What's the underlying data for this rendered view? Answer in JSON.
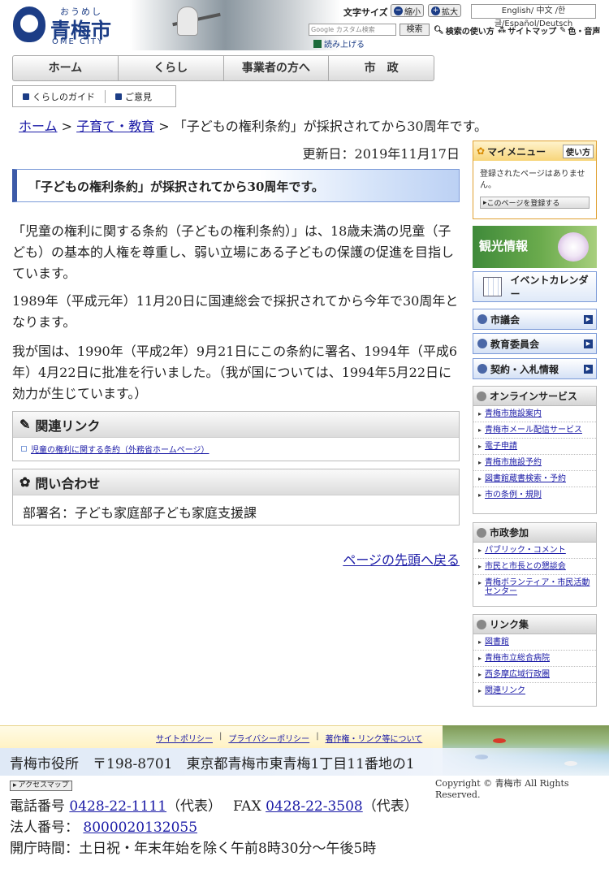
{
  "header": {
    "logo_kana": "おうめし",
    "logo_name": "青梅市",
    "logo_en": "OME CITY",
    "font_size_label": "文字サイズ",
    "shrink_label": "縮小",
    "enlarge_label": "拡大",
    "languages": "English/ 中文 /한글/Español/Deutsch",
    "search_placeholder": "Google カスタム検索",
    "search_button": "検索",
    "search_help": "検索の使い方",
    "sitemap": "サイトマップ",
    "color_voice": "色・音声",
    "read_aloud": "読み上げる"
  },
  "gnav": [
    "ホーム",
    "くらし",
    "事業者の方へ",
    "市　政"
  ],
  "subnav": {
    "guide": "くらしのガイド",
    "opinion": "ご意見"
  },
  "breadcrumb": {
    "home": "ホーム",
    "sep1": " > ",
    "category": "子育て・教育",
    "sep2": " > ",
    "current": "「子どもの権利条約」が採択されてから30周年です。"
  },
  "main": {
    "updated": "更新日：2019年11月17日",
    "title": "「子どもの権利条約」が採択されてから30周年です。",
    "para1": "「児童の権利に関する条約（子どもの権利条約）」は、18歳未満の児童（子ども）の基本的人権を尊重し、弱い立場にある子どもの保護の促進を目指しています。",
    "para2": "1989年（平成元年）11月20日に国連総会で採択されてから今年で30周年となります。",
    "para3": "我が国は、1990年（平成2年）9月21日にこの条約に署名、1994年（平成6年）4月22日に批准を行いました。（我が国については、1994年5月22日に効力が生じています。）",
    "related_heading": "関連リンク",
    "related_link": "児童の権利に関する条約（外務省ホームページ）",
    "contact_heading": "問い合わせ",
    "contact_dept": "部署名：子ども家庭部子ども家庭支援課",
    "page_top": "ページの先頭へ戻る"
  },
  "sidebar": {
    "mymenu_title": "マイメニュー",
    "mymenu_howto": "使い方",
    "mymenu_msg": "登録されたページはありません。",
    "mymenu_register": "このページを登録する",
    "tourism": "観光情報",
    "event_calendar": "イベントカレンダー",
    "council": "市議会",
    "education": "教育委員会",
    "contract": "契約・入札情報",
    "online_title": "オンラインサービス",
    "online_items": [
      "青梅市施設案内",
      "青梅市メール配信サービス",
      "電子申請",
      "青梅市施設予約",
      "図書館蔵書検索・予約",
      "市の条例・規則"
    ],
    "citizen_title": "市政参加",
    "citizen_items": [
      "パブリック・コメント",
      "市民と市長との懇談会",
      "青梅ボランティア・市民活動センター"
    ],
    "links_title": "リンク集",
    "links_items": [
      "図書館",
      "青梅市立総合病院",
      "西多摩広域行政圏",
      "関連リンク"
    ]
  },
  "footer": {
    "site_policy": "サイトポリシー",
    "privacy_policy": "プライバシーポリシー",
    "copyright_links": "著作権・リンク等について",
    "address": "青梅市役所　〒198-8701　東京都青梅市東青梅1丁目11番地の1",
    "access_map": "アクセスマップ",
    "tel_label": "電話番号",
    "tel": "0428-22-1111",
    "tel_note": "（代表）",
    "fax_label": "FAX",
    "fax": "0428-22-3508",
    "fax_note": "（代表）",
    "corp_label": "法人番号：",
    "corp_no": "8000020132055",
    "hours": "開庁時間：土日祝・年末年始を除く午前8時30分～午後5時",
    "copyright": "Copyright © 青梅市 All Rights Reserved."
  },
  "colors": {
    "brand": "#1c3d86",
    "link": "#1a1aa6",
    "title_border": "#3c5aa8",
    "mymenu_border": "#e0a030"
  }
}
